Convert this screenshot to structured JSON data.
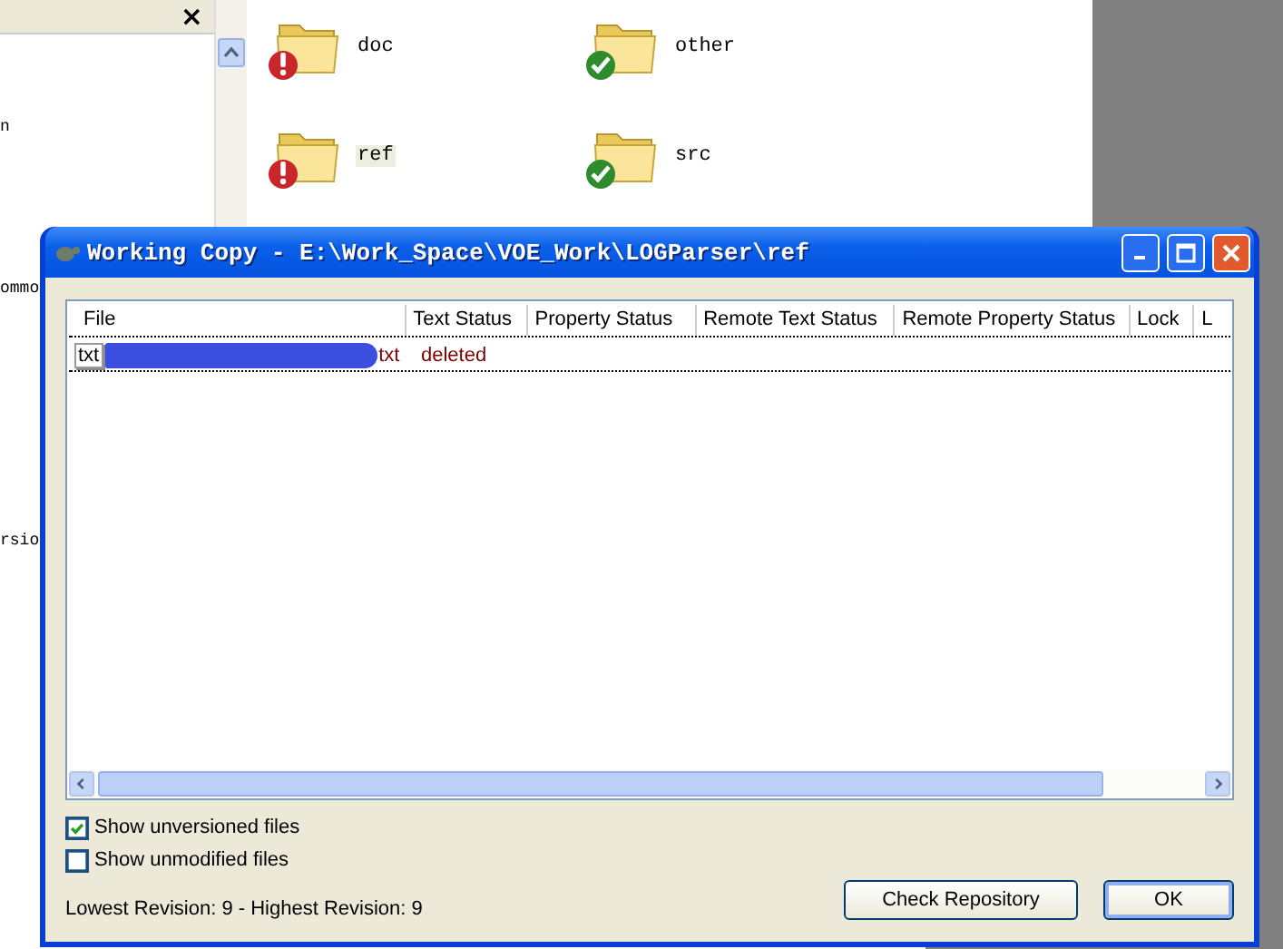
{
  "explorer": {
    "close_glyph": "×",
    "tree_items": [
      "n",
      "ommo",
      "rsio"
    ],
    "folders": [
      {
        "name": "doc",
        "kind": "modified",
        "selected": false
      },
      {
        "name": "other",
        "kind": "normal",
        "selected": false
      },
      {
        "name": "ref",
        "kind": "modified",
        "selected": true
      },
      {
        "name": "src",
        "kind": "normal",
        "selected": false
      }
    ]
  },
  "dialog": {
    "title": "Working Copy - E:\\Work_Space\\VOE_Work\\LOGParser\\ref",
    "columns": [
      "File",
      "Text Status",
      "Property Status",
      "Remote Text Status",
      "Remote Property Status",
      "Lock",
      "L"
    ],
    "rows": [
      {
        "file_start": "txt",
        "file_end": "txt",
        "text_status": "deleted"
      }
    ],
    "checkboxes": [
      {
        "label": "Show unversioned files",
        "checked": true
      },
      {
        "label": "Show unmodified files",
        "checked": false
      }
    ],
    "revision_info": "Lowest Revision: 9 - Highest Revision: 9",
    "buttons": [
      {
        "label": "Check Repository",
        "default": false
      },
      {
        "label": "OK",
        "default": true
      }
    ]
  }
}
